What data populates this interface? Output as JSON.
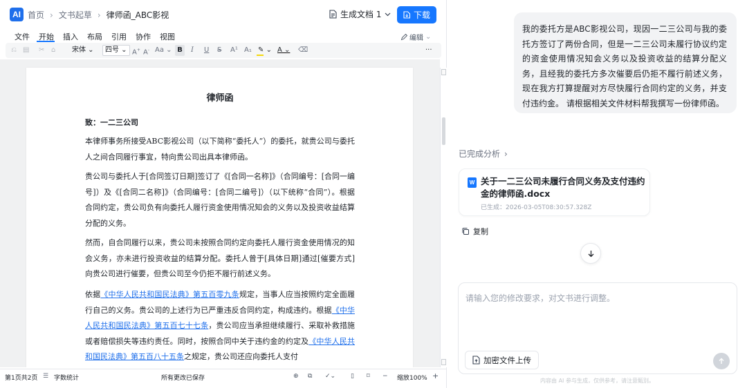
{
  "header": {
    "logo": "AI",
    "breadcrumb": [
      "首页",
      "文书起草",
      "律师函_ABC影视"
    ],
    "generated_doc_label": "生成文档 1",
    "download_label": "下载"
  },
  "menu": {
    "items": [
      "文件",
      "开始",
      "插入",
      "布局",
      "引用",
      "协作",
      "视图"
    ],
    "active": "开始",
    "edit_mode": "编辑"
  },
  "toolbar": {
    "font_family": "宋体",
    "font_size": "四号",
    "bold": "B",
    "italic": "I",
    "underline": "U",
    "strike": "S",
    "superscript": "A¹",
    "subscript": "A₁",
    "grow": "A",
    "shrink": "A",
    "case": "Aa",
    "more": "···"
  },
  "document": {
    "title": "律师函",
    "to": "致：一二三公司",
    "paragraphs": [
      "本律师事务所接受ABC影视公司（以下简称“委托人”）的委托，就贵公司与委托人之间合同履行事宜，特向贵公司出具本律师函。",
      "贵公司与委托人于[合同签订日期]签订了《[合同一名称]》（合同编号：[合同一编号]）及《[合同二名称]》（合同编号：[合同二编号]）（以下统称“合同”）。根据合同约定，贵公司负有向委托人履行资金使用情况知会的义务以及投资收益结算分配的义务。",
      "然而，自合同履行以来，贵公司未按照合同约定向委托人履行资金使用情况的知会义务，亦未进行投资收益的结算分配。委托人曾于[具体日期]通过[催要方式]向贵公司进行催要，但贵公司至今仍拒不履行前述义务。"
    ],
    "p4": {
      "t1": "依据",
      "l1": "《中华人民共和国民法典》第五百零九条",
      "t2": "规定，当事人应当按照约定全面履行自己的义务。贵公司的上述行为已严重违反合同约定，构成违约。根据",
      "l2": "《中华人民共和国民法典》第五百七十七条",
      "t3": "，贵公司应当承担继续履行、采取补救措施或者赔偿损失等违约责任。同时，按照合同中关于违约金的约定及",
      "l3": "《中华人民共和国民法典》第五百八十五条",
      "t4": "之规定，贵公司还应向委托人支付"
    }
  },
  "status": {
    "pages": "第1页共2页",
    "word_count": "字数统计",
    "saved": "所有更改已保存",
    "zoom": "缩放100%"
  },
  "chat": {
    "user_message": "我的委托方是ABC影视公司，现因一二三公司与我的委托方签订了两份合同，但是一二三公司未履行协议约定的资金使用情况知会义务以及投资收益的结算分配义务，且经我的委托方多次催要后仍拒不履行前述义务，现在我方打算提醒对方尽快履行合同约定的义务，并支付违约金。 请根据相关文件材料帮我撰写一份律师函。",
    "analysis_done": "已完成分析",
    "file_name": "关于一二三公司未履行合同义务及支付违约金的律师函.docx",
    "file_time": "已生成：2026-03-05T08:30:57.328Z",
    "copy_label": "复制",
    "input_placeholder": "请输入您的修改要求，对文书进行调整。",
    "upload_label": "加密文件上传",
    "disclaimer": "内容由 AI 参与生成，仅供参考，请注意甄别。"
  },
  "colors": {
    "accent": "#1677ff",
    "link": "#1f6feb",
    "bubble": "#f2f3f5"
  }
}
